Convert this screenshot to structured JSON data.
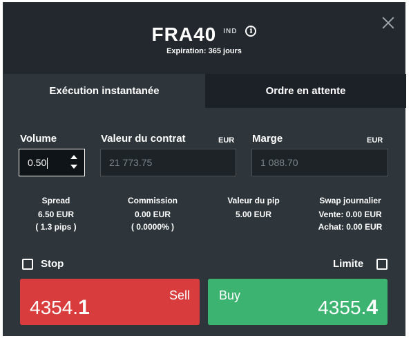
{
  "header": {
    "symbol": "FRA40",
    "badge": "IND",
    "expiration": "Expiration: 365 jours"
  },
  "tabs": [
    {
      "label": "Exécution instantanée",
      "active": true
    },
    {
      "label": "Ordre en attente",
      "active": false
    }
  ],
  "volume": {
    "label": "Volume",
    "value": "0.50"
  },
  "contract_value": {
    "label": "Valeur du contrat",
    "currency": "EUR",
    "value": "21 773.75"
  },
  "margin": {
    "label": "Marge",
    "currency": "EUR",
    "value": "1 088.70"
  },
  "stats": {
    "spread": {
      "label": "Spread",
      "value": "6.50 EUR",
      "sub": "( 1.3 pips )"
    },
    "commission": {
      "label": "Commission",
      "value": "0.00 EUR",
      "sub": "( 0.0000% )"
    },
    "pip_value": {
      "label": "Valeur du pip",
      "value": "5.00 EUR"
    },
    "swap": {
      "label": "Swap journalier",
      "sell": "Vente: 0.00 EUR",
      "buy": "Achat: 0.00 EUR"
    }
  },
  "stop": {
    "label": "Stop",
    "checked": false
  },
  "limit": {
    "label": "Limite",
    "checked": false
  },
  "sell": {
    "label": "Sell",
    "price_main": "4354.",
    "price_bold": "1"
  },
  "buy": {
    "label": "Buy",
    "price_main": "4355.",
    "price_bold": "4"
  },
  "colors": {
    "panel_bg": "#22282d",
    "body_bg": "#2e363c",
    "sell": "#d93c3c",
    "buy": "#3cb371"
  }
}
